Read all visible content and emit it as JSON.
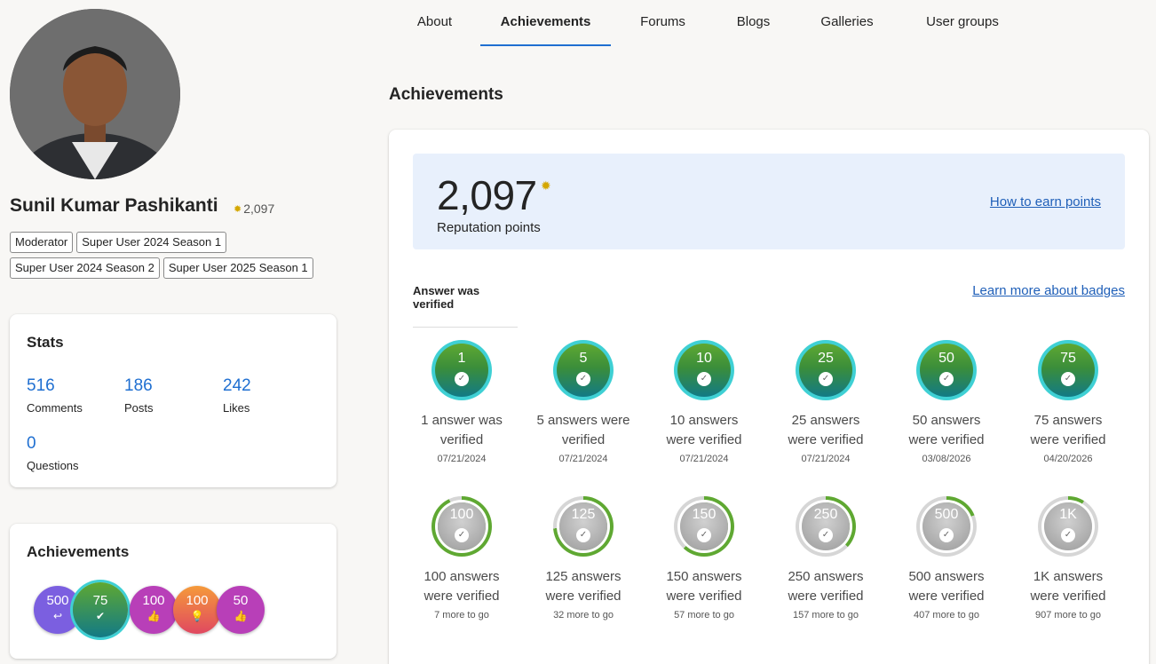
{
  "profile": {
    "name": "Sunil Kumar Pashikanti",
    "points": "2,097",
    "tags": [
      "Moderator",
      "Super User 2024 Season 1",
      "Super User 2024 Season 2",
      "Super User 2025 Season 1"
    ]
  },
  "stats": {
    "title": "Stats",
    "items": [
      {
        "value": "516",
        "label": "Comments"
      },
      {
        "value": "186",
        "label": "Posts"
      },
      {
        "value": "242",
        "label": "Likes"
      },
      {
        "value": "0",
        "label": "Questions"
      }
    ]
  },
  "sidebar_achievements": {
    "title": "Achievements",
    "badges": [
      {
        "value": "500",
        "color": "#7b5fe0",
        "icon": "reply-icon"
      },
      {
        "value": "75",
        "color": "#2f8f6a",
        "icon": "check-icon"
      },
      {
        "value": "100",
        "color": "#b83fb8",
        "icon": "thumbs-up-icon"
      },
      {
        "value": "100",
        "color": "#e5643a",
        "icon": "lightbulb-icon"
      },
      {
        "value": "50",
        "color": "#b83fb8",
        "icon": "thumbs-up-icon"
      }
    ]
  },
  "tabs": [
    "About",
    "Achievements",
    "Forums",
    "Blogs",
    "Galleries",
    "User groups"
  ],
  "active_tab": "Achievements",
  "section_title": "Achievements",
  "reputation": {
    "value": "2,097",
    "label": "Reputation points",
    "link": "How to earn points"
  },
  "badge_section": {
    "subtab": "Answer was verified",
    "link": "Learn more about badges",
    "badges": [
      {
        "value": "1",
        "title1": "1 answer was",
        "title2": "verified",
        "sub": "07/21/2024",
        "earned": true,
        "progress": 1
      },
      {
        "value": "5",
        "title1": "5 answers were",
        "title2": "verified",
        "sub": "07/21/2024",
        "earned": true,
        "progress": 1
      },
      {
        "value": "10",
        "title1": "10 answers",
        "title2": "were verified",
        "sub": "07/21/2024",
        "earned": true,
        "progress": 1
      },
      {
        "value": "25",
        "title1": "25 answers",
        "title2": "were verified",
        "sub": "07/21/2024",
        "earned": true,
        "progress": 1
      },
      {
        "value": "50",
        "title1": "50 answers",
        "title2": "were verified",
        "sub": "03/08/2026",
        "earned": true,
        "progress": 1
      },
      {
        "value": "75",
        "title1": "75 answers",
        "title2": "were verified",
        "sub": "04/20/2026",
        "earned": true,
        "progress": 1
      },
      {
        "value": "100",
        "title1": "100 answers",
        "title2": "were verified",
        "sub": "7 more to go",
        "earned": false,
        "progress": 0.93
      },
      {
        "value": "125",
        "title1": "125 answers",
        "title2": "were verified",
        "sub": "32 more to go",
        "earned": false,
        "progress": 0.74
      },
      {
        "value": "150",
        "title1": "150 answers",
        "title2": "were verified",
        "sub": "57 more to go",
        "earned": false,
        "progress": 0.62
      },
      {
        "value": "250",
        "title1": "250 answers",
        "title2": "were verified",
        "sub": "157 more to go",
        "earned": false,
        "progress": 0.37
      },
      {
        "value": "500",
        "title1": "500 answers",
        "title2": "were verified",
        "sub": "407 more to go",
        "earned": false,
        "progress": 0.19
      },
      {
        "value": "1K",
        "title1": "1K answers",
        "title2": "were verified",
        "sub": "907 more to go",
        "earned": false,
        "progress": 0.09
      }
    ]
  },
  "colors": {
    "accent": "#1f6fd1",
    "link": "#1f5fb8",
    "progress": "#5fa832"
  }
}
